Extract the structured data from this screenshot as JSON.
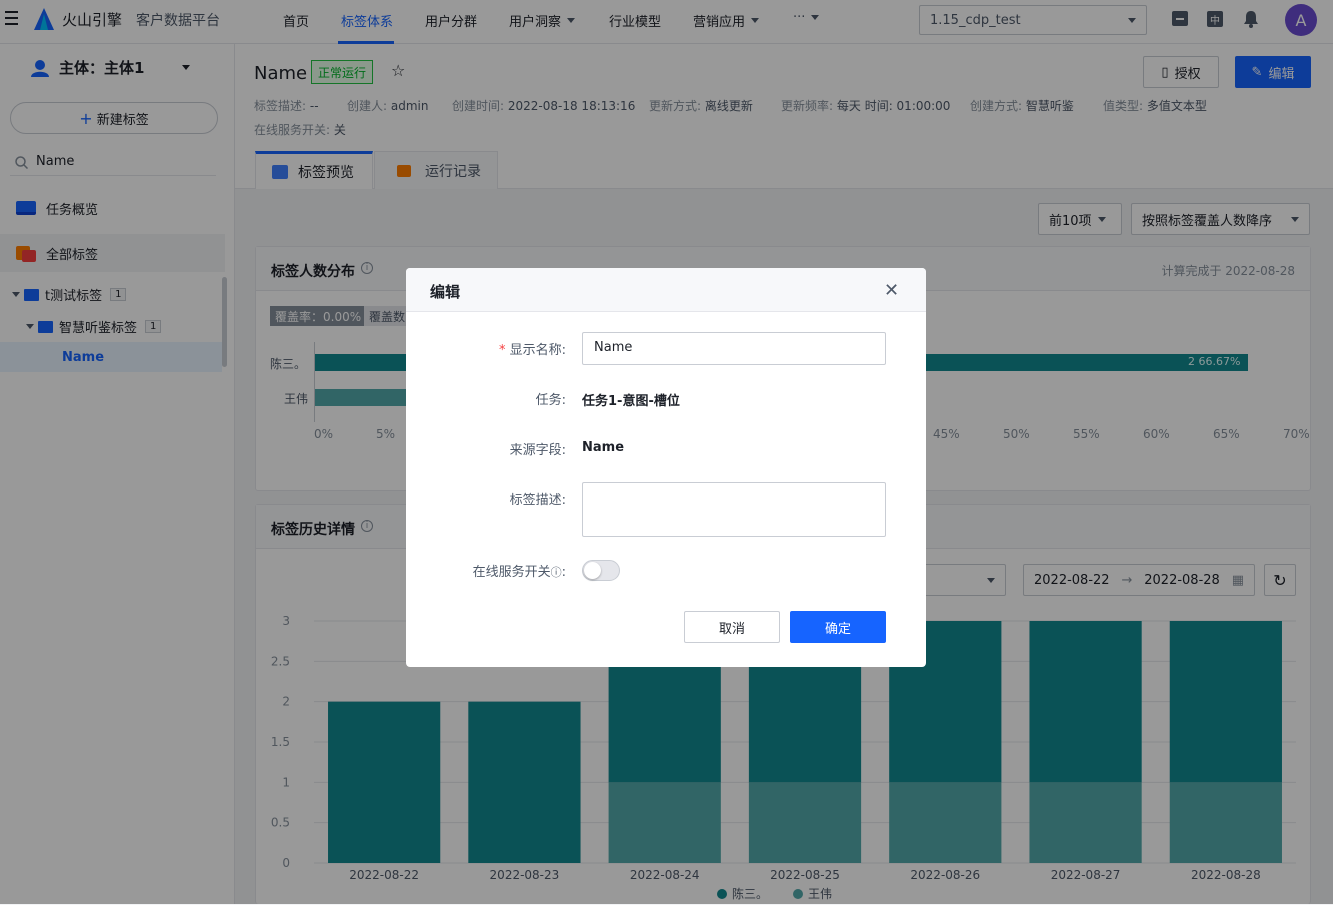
{
  "app": {
    "brand": "火山引擎",
    "product": "客户数据平台"
  },
  "nav": {
    "items": [
      "首页",
      "标签体系",
      "用户分群",
      "用户洞察",
      "行业模型",
      "营销应用",
      "···"
    ],
    "active_index": 1,
    "project": "1.15_cdp_test",
    "avatar": "A",
    "lang_badge": "中"
  },
  "sidebar": {
    "subject": "主体：主体1",
    "new_tag": "新建标签",
    "search_value": "Name",
    "items": [
      {
        "label": "任务概览"
      },
      {
        "label": "全部标签"
      }
    ],
    "tree": [
      {
        "label": "t测试标签",
        "count": "1"
      },
      {
        "label": "智慧听鉴标签",
        "count": "1"
      },
      {
        "label": "Name"
      }
    ]
  },
  "header": {
    "title": "Name",
    "status": "正常运行",
    "authorize": "授权",
    "edit": "编辑"
  },
  "meta": [
    {
      "k": "标签描述:",
      "v": "--"
    },
    {
      "k": "创建人:",
      "v": "admin"
    },
    {
      "k": "创建时间:",
      "v": "2022-08-18 18:13:16"
    },
    {
      "k": "更新方式:",
      "v": "离线更新"
    },
    {
      "k": "更新频率:",
      "v": "每天 时间: 01:00:00"
    },
    {
      "k": "创建方式:",
      "v": "智慧听鉴"
    },
    {
      "k": "值类型:",
      "v": "多值文本型"
    },
    {
      "k": "在线服务开关:",
      "v": "关"
    }
  ],
  "tabs": [
    "标签预览",
    "运行记录"
  ],
  "filters": {
    "top": "前10项",
    "sort": "按照标签覆盖人数降序"
  },
  "dist": {
    "title": "标签人数分布",
    "computed": "计算完成于 2022-08-28",
    "coverage": "覆盖率：0.00%",
    "coverage2": "覆盖数",
    "bar_label": "2 66.67%"
  },
  "history": {
    "title": "标签历史详情",
    "date_from": "2022-08-22",
    "date_to": "2022-08-28"
  },
  "chart_data": [
    {
      "type": "bar",
      "orientation": "horizontal",
      "categories": [
        "陈三。",
        "王伟"
      ],
      "values": [
        66.67,
        33.33
      ],
      "x_ticks": [
        "0%",
        "5%",
        "45%",
        "50%",
        "55%",
        "60%",
        "65%",
        "70%"
      ]
    },
    {
      "type": "bar",
      "stacked": true,
      "categories": [
        "2022-08-22",
        "2022-08-23",
        "2022-08-24",
        "2022-08-25",
        "2022-08-26",
        "2022-08-27",
        "2022-08-28"
      ],
      "y_ticks": [
        "0",
        "0.5",
        "1",
        "1.5",
        "2",
        "2.5",
        "3"
      ],
      "ylim": [
        0,
        3
      ],
      "series": [
        {
          "name": "陈三。",
          "values": [
            2,
            2,
            2,
            2,
            2,
            2,
            2
          ],
          "color": "#12898f"
        },
        {
          "name": "王伟",
          "values": [
            0,
            0,
            1,
            1,
            1,
            1,
            1
          ],
          "color": "#52a8aa"
        }
      ]
    }
  ],
  "modal": {
    "title": "编辑",
    "fields": [
      {
        "label": "显示名称",
        "value": "Name"
      },
      {
        "label": "任务",
        "value": "任务1-意图-槽位"
      },
      {
        "label": "来源字段",
        "value": "Name"
      },
      {
        "label": "标签描述",
        "value": ""
      },
      {
        "label": "在线服务开关",
        "value": "off"
      }
    ],
    "cancel": "取消",
    "ok": "确定"
  }
}
